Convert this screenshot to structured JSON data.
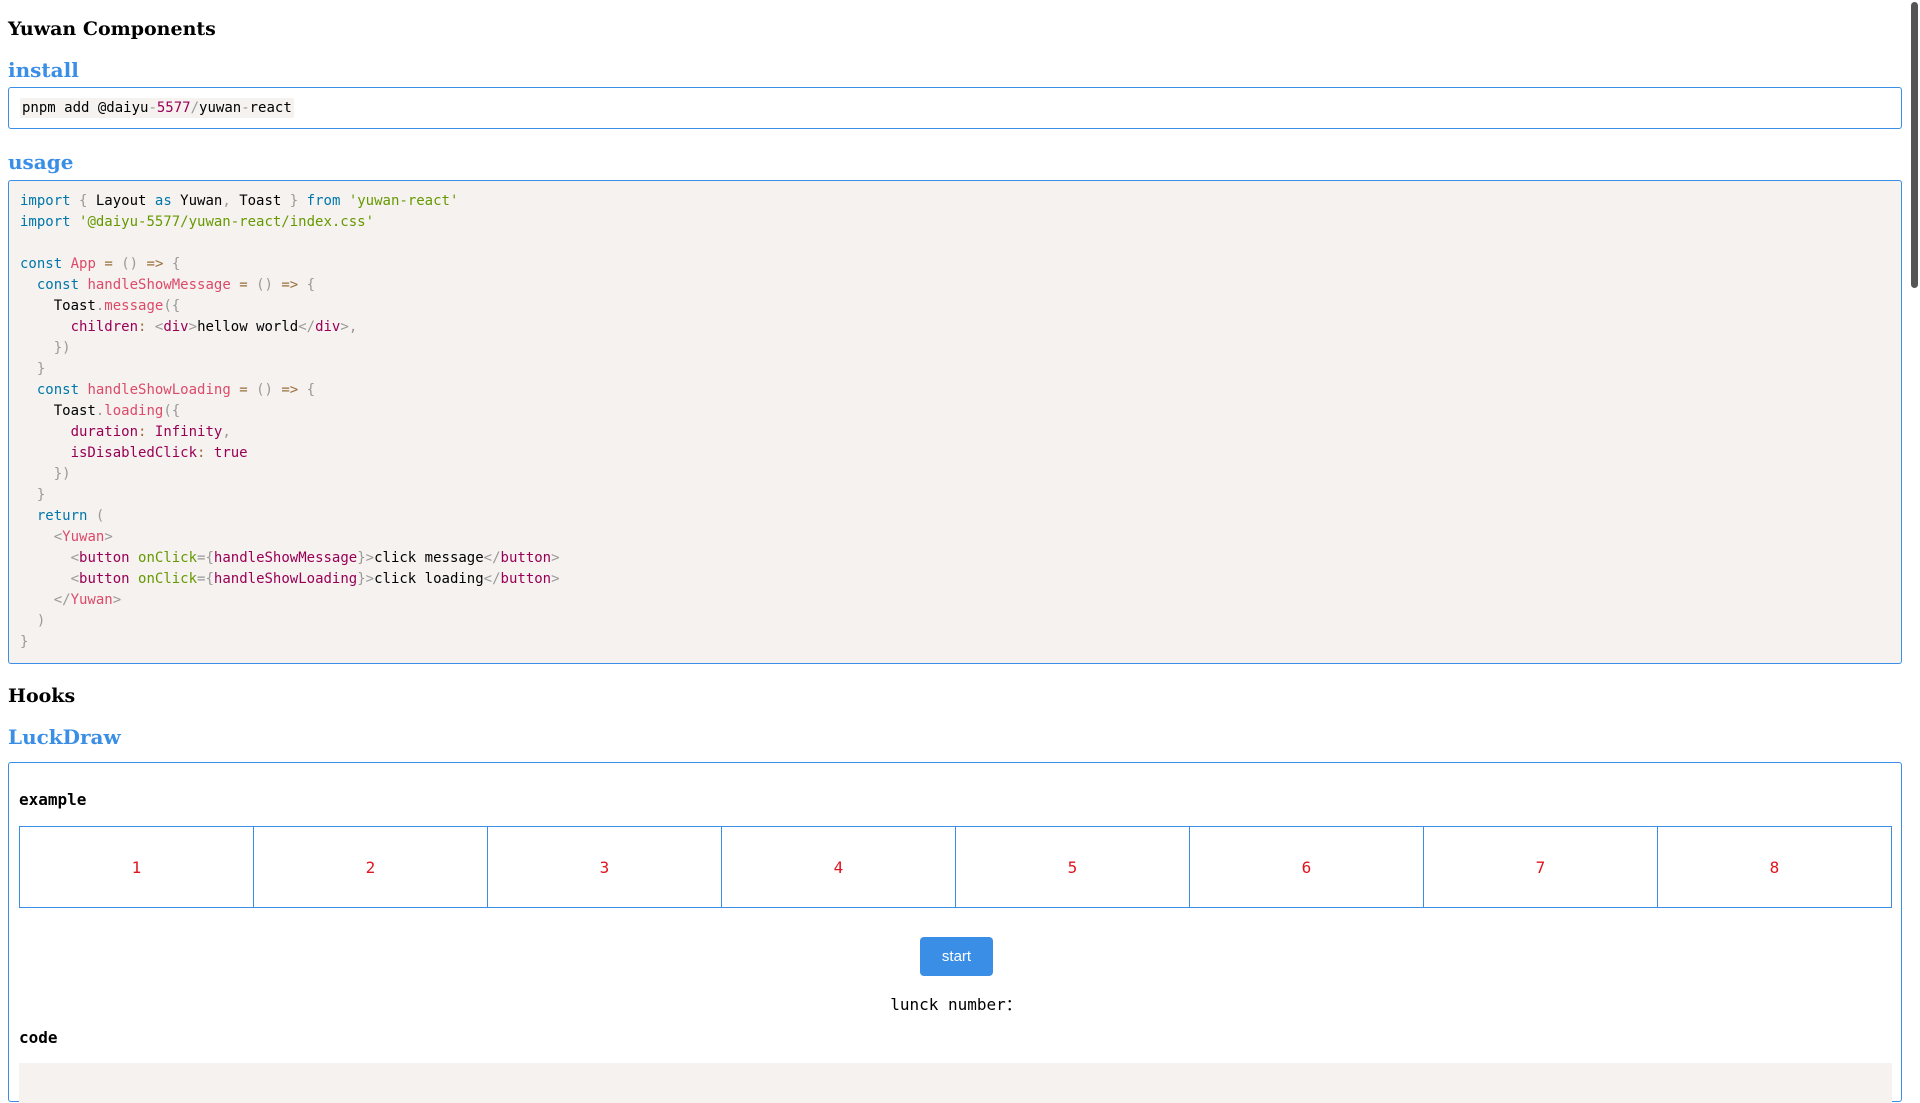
{
  "page": {
    "title": "Yuwan Components",
    "install": {
      "heading": "install",
      "command": "pnpm add @daiyu-5577/yuwan-react"
    },
    "usage": {
      "heading": "usage"
    },
    "hooks_title": "Hooks",
    "luckdraw": {
      "heading": "LuckDraw",
      "example_label": "example",
      "cells": [
        "1",
        "2",
        "3",
        "4",
        "5",
        "6",
        "7",
        "8"
      ],
      "start_label": "start",
      "lucky_label": "lunck number：",
      "code_label": "code"
    }
  },
  "colors": {
    "accent": "#3a8ee6",
    "cell_text": "#e0141e",
    "code_bg": "#f5f2f0"
  }
}
